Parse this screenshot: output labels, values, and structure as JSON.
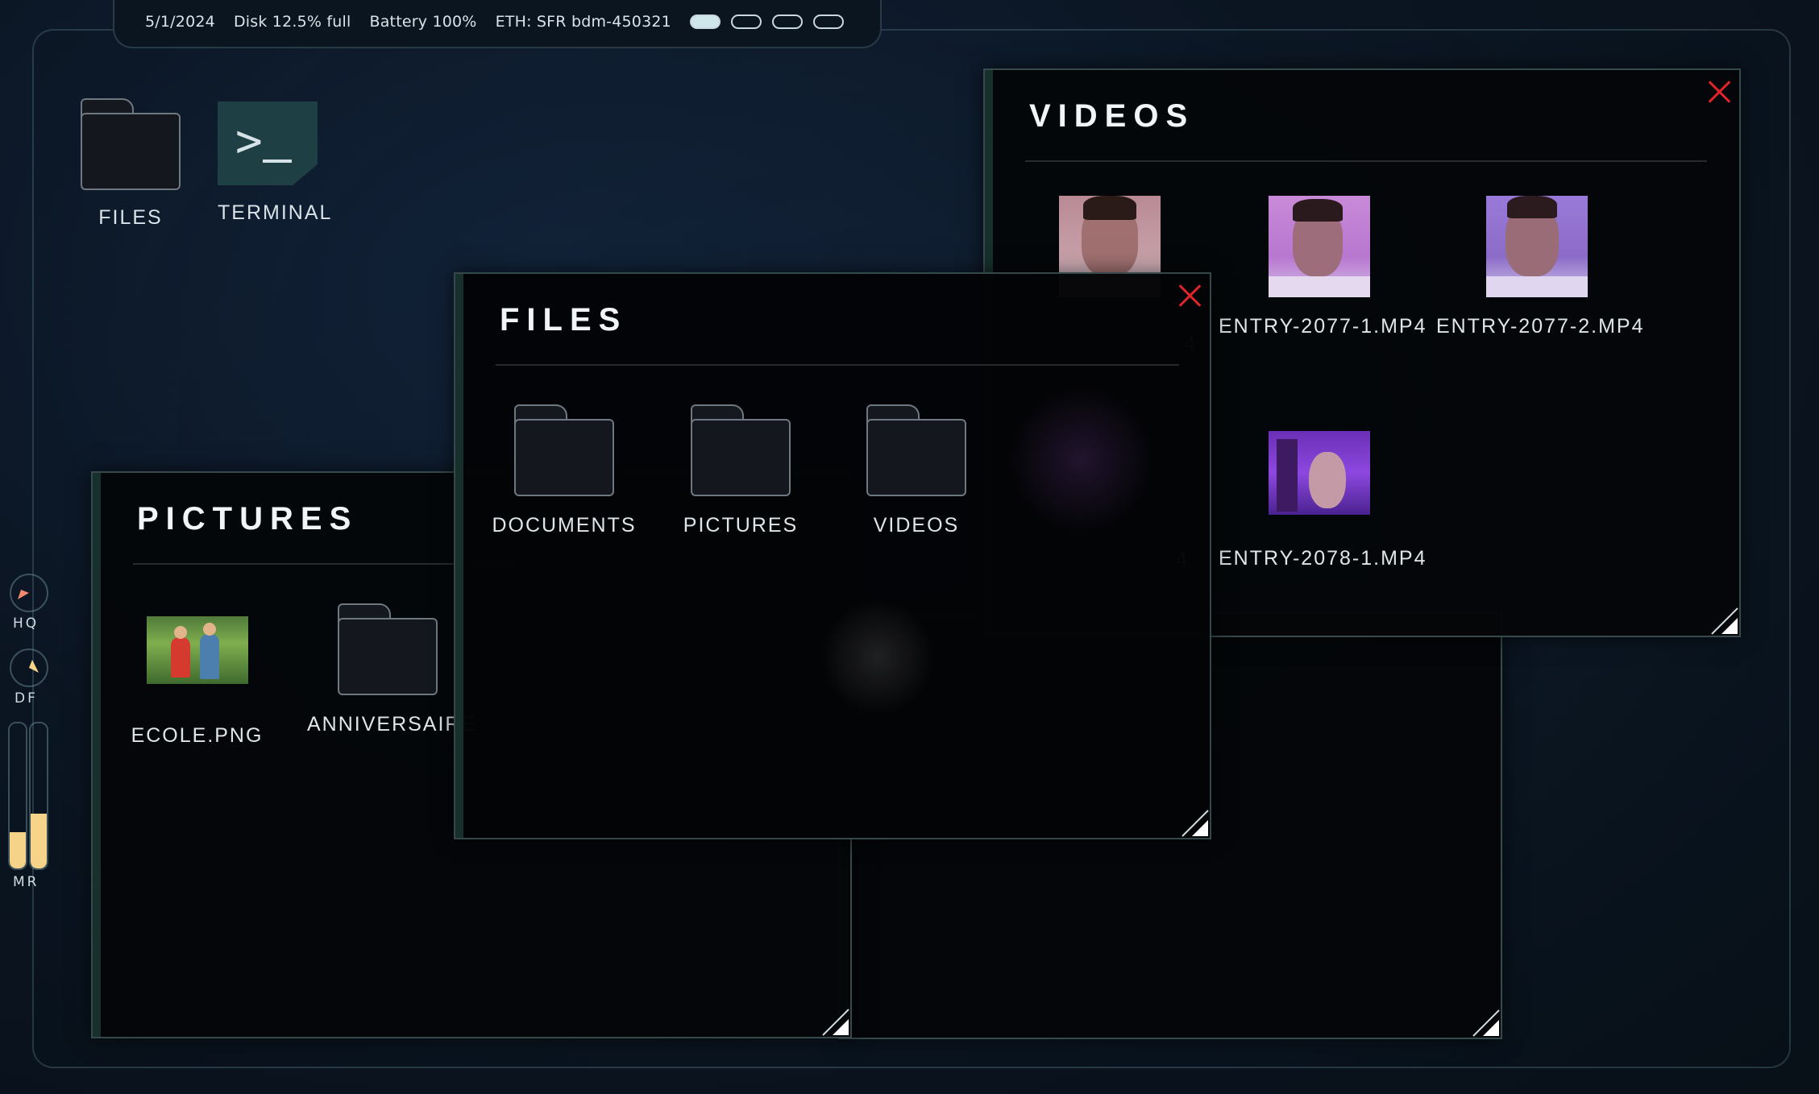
{
  "status": {
    "date": "5/1/2024",
    "disk": "Disk 12.5% full",
    "battery": "Battery 100%",
    "network": "ETH: SFR bdm-450321"
  },
  "desktop": {
    "icons": [
      {
        "label": "FILES",
        "icon": "folder-icon"
      },
      {
        "label": "TERMINAL",
        "icon": "terminal-icon"
      }
    ]
  },
  "side_widgets": {
    "hq_label": "HQ",
    "df_label": "DF",
    "mr_label": "MR",
    "meter_levels": [
      0.25,
      0.38
    ]
  },
  "windows": {
    "videos": {
      "title": "VIDEOS",
      "items": [
        {
          "label": "ENTRY-2077-1.MP4"
        },
        {
          "label": "ENTRY-2077-2.MP4"
        },
        {
          "label": "ENTRY-2078-1.MP4"
        },
        {
          "label": "4"
        },
        {
          "label": "4"
        }
      ]
    },
    "pictures": {
      "title": "PICTURES",
      "items": [
        {
          "label": "ECOLE.PNG"
        },
        {
          "label": "ANNIVERSAIRE"
        }
      ]
    },
    "files": {
      "title": "FILES",
      "items": [
        {
          "label": "DOCUMENTS"
        },
        {
          "label": "PICTURES"
        },
        {
          "label": "VIDEOS"
        }
      ]
    }
  },
  "colors": {
    "accent": "#1e3f43",
    "close": "#e0242a",
    "meter": "#f5d48a"
  }
}
